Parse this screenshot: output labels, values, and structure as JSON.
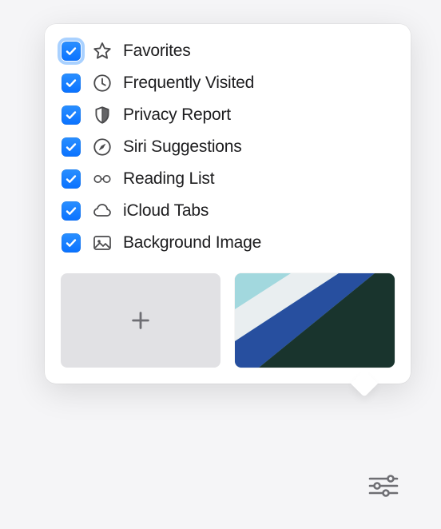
{
  "options": [
    {
      "id": "favorites",
      "label": "Favorites",
      "icon": "star",
      "checked": true,
      "focused": true
    },
    {
      "id": "frequently-visited",
      "label": "Frequently Visited",
      "icon": "clock",
      "checked": true,
      "focused": false
    },
    {
      "id": "privacy-report",
      "label": "Privacy Report",
      "icon": "shield",
      "checked": true,
      "focused": false
    },
    {
      "id": "siri-suggestions",
      "label": "Siri Suggestions",
      "icon": "compass",
      "checked": true,
      "focused": false
    },
    {
      "id": "reading-list",
      "label": "Reading List",
      "icon": "glasses",
      "checked": true,
      "focused": false
    },
    {
      "id": "icloud-tabs",
      "label": "iCloud Tabs",
      "icon": "cloud",
      "checked": true,
      "focused": false
    },
    {
      "id": "background-image",
      "label": "Background Image",
      "icon": "image",
      "checked": true,
      "focused": false
    }
  ],
  "colors": {
    "accent": "#0a72ff",
    "wallpaper": {
      "stripe1": "#a2d8de",
      "stripe2": "#e9eef0",
      "stripe3": "#274f9f",
      "stripe4": "#19342d"
    }
  }
}
